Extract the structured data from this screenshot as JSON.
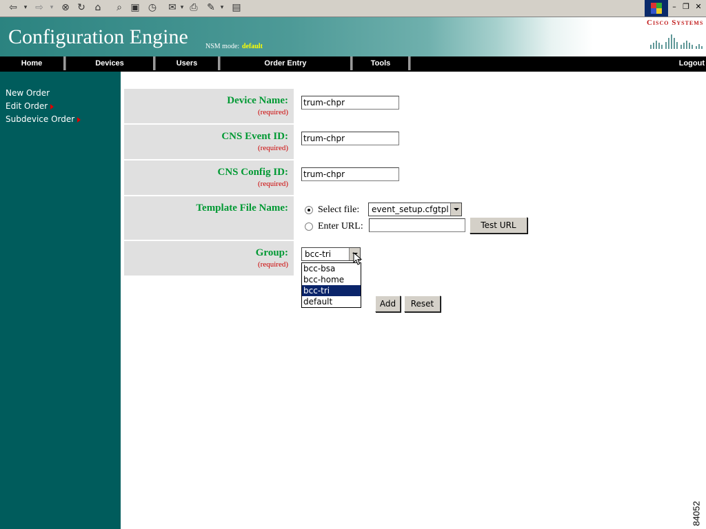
{
  "browser": {
    "icons": [
      "back-arrow-icon",
      "back-dropdown-icon",
      "forward-arrow-icon",
      "forward-dropdown-icon",
      "stop-icon",
      "refresh-icon",
      "home-icon",
      "search-icon",
      "favorites-icon",
      "history-icon",
      "mail-icon",
      "mail-dropdown-icon",
      "print-icon",
      "edit-icon",
      "edit-dropdown-icon",
      "discuss-icon"
    ],
    "window_buttons": {
      "minimize": "–",
      "restore": "❐",
      "close": "✕"
    }
  },
  "header": {
    "title": "Configuration Engine",
    "nsm_label": "NSM mode:",
    "nsm_value": "default",
    "logo_text": "Cisco Systems"
  },
  "nav": {
    "items": [
      {
        "label": "Home"
      },
      {
        "label": "Devices"
      },
      {
        "label": "Users"
      },
      {
        "label": "Order Entry"
      },
      {
        "label": "Tools"
      }
    ],
    "logout": "Logout"
  },
  "sidebar": {
    "items": [
      {
        "label": "New Order",
        "has_arrow": false
      },
      {
        "label": "Edit Order",
        "has_arrow": true
      },
      {
        "label": "Subdevice Order",
        "has_arrow": true
      }
    ]
  },
  "form": {
    "device_name": {
      "label": "Device Name:",
      "required": "(required)",
      "value": "trum-chpr"
    },
    "event_id": {
      "label": "CNS Event ID:",
      "required": "(required)",
      "value": "trum-chpr"
    },
    "config_id": {
      "label": "CNS Config ID:",
      "required": "(required)",
      "value": "trum-chpr"
    },
    "template": {
      "label": "Template File Name:",
      "select_file_label": "Select file:",
      "select_file_value": "event_setup.cfgtpl",
      "enter_url_label": "Enter URL:",
      "url_value": "",
      "test_url_button": "Test URL",
      "selected_option": "select_file"
    },
    "group": {
      "label": "Group:",
      "required": "(required)",
      "value": "bcc-tri",
      "options": [
        "bcc-bsa",
        "bcc-home",
        "bcc-tri",
        "default"
      ],
      "highlighted": "bcc-tri"
    },
    "add_button": "Add",
    "reset_button": "Reset"
  },
  "figure_number": "84052",
  "colors": {
    "sidebar": "#005c5c",
    "field_label": "#009933",
    "required": "#cc0000",
    "nav_bg": "#000000",
    "selection": "#0a246a",
    "nsm_value": "#ffff00"
  }
}
